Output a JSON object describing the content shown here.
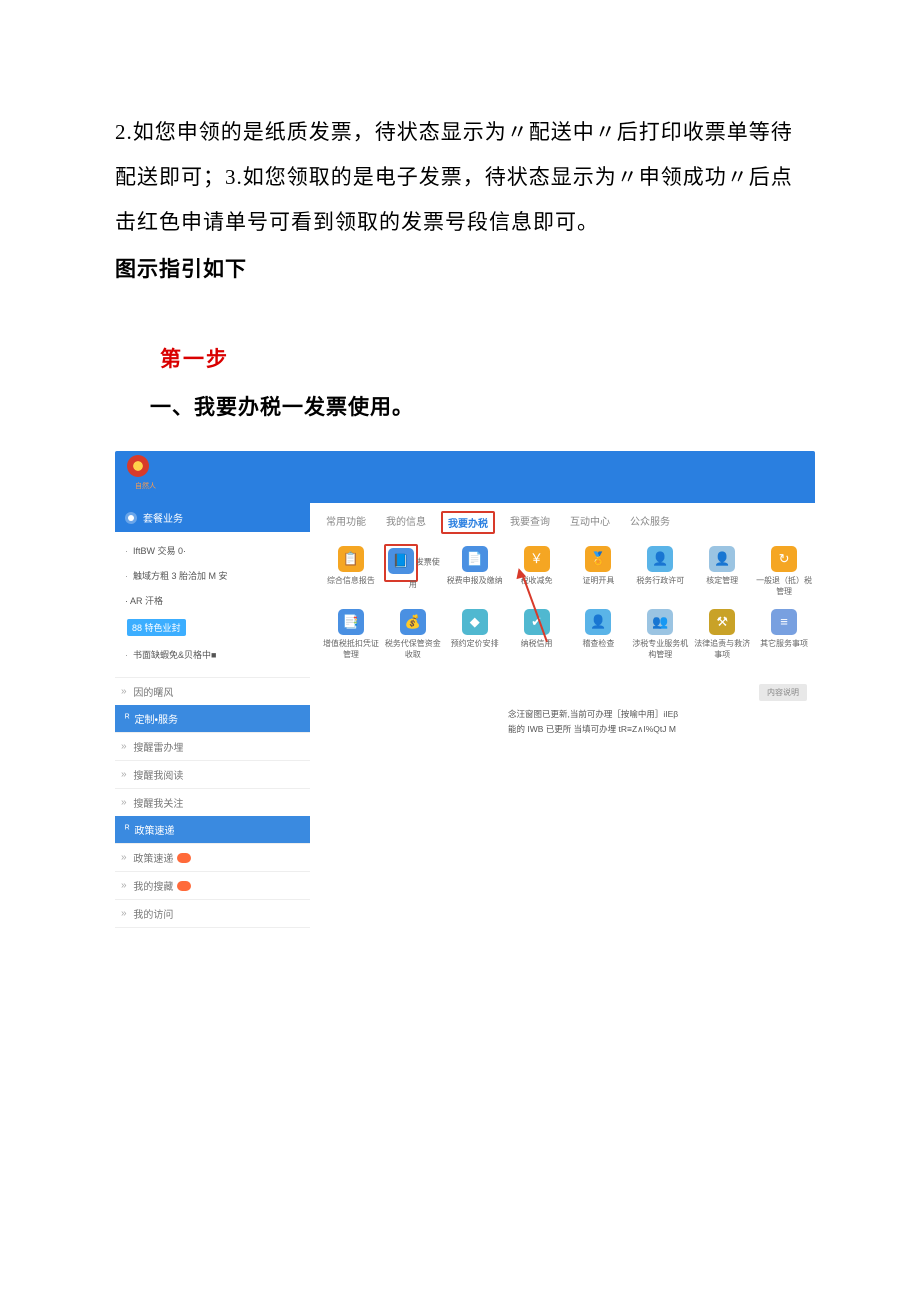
{
  "body_text": "2.如您申领的是纸质发票，待状态显示为〃配送中〃后打印收票单等待配送即可；3.如您领取的是电子发票，待状态显示为〃申领成功〃后点击红色申请单号可看到领取的发票号段信息即可。",
  "heading_bold": "图示指引如下",
  "step_label": "第一步",
  "step_desc": "一、我要办税一发票使用。",
  "screenshot": {
    "top_sub": "自然人",
    "sidebar1": {
      "header": "套餐业务",
      "items": [
        "IftBW 交易 0·",
        "触域方粗 3 胎洽加 M 安",
        "· AR 汗格",
        "88 特色业封",
        "书面缺蝦免&贝格中■"
      ]
    },
    "sidebar2": {
      "header": "定制•服务",
      "items_pre": "因的曙风",
      "items": [
        "搜醒雷办埋",
        "搜醒我阅读",
        "搜醒我关注"
      ]
    },
    "sidebar3": {
      "header": "政策速递",
      "items": [
        "政策速递",
        "我的搜藏",
        "我的访问"
      ]
    },
    "tabs": [
      "常用功能",
      "我的信息",
      "我要办税",
      "我要查询",
      "互动中心",
      "公众服务"
    ],
    "icons_row1": [
      "综合信息报告",
      "发票使用",
      "税费申报及缴纳",
      "税收减免",
      "证明开具",
      "税务行政许可",
      "核定管理",
      "一般退（抵）税管理"
    ],
    "icons_row2": [
      "增值税抵扣凭证管理",
      "税务代保管资金收取",
      "预约定价安排",
      "纳税信用",
      "稽查检查",
      "涉税专业服务机构管理",
      "法律追责与救济事项",
      "其它服务事项"
    ],
    "notice_btn": "内容说明",
    "notice_line1": "念汪窗图已更新,当前可办理［按喻中用］iIEβ",
    "notice_line2": "能的 IWB 已更所 当填可办埋 tR≡Z∧I%QtJ M"
  }
}
